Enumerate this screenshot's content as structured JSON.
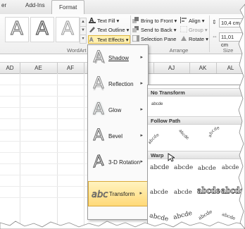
{
  "tabs": [
    "er",
    "Add-Ins",
    "Format"
  ],
  "ribbon": {
    "wordart_letter": "A",
    "group_wordart": "WordArt Styles",
    "group_arrange": "Arrange",
    "group_size": "Size",
    "text_fill": "Text Fill ▾",
    "text_outline": "Text Outline ▾",
    "text_effects": "Text Effects ▾",
    "bring_to_front": "Bring to Front ▾",
    "send_to_back": "Send to Back ▾",
    "selection_pane": "Selection Pane",
    "align": "Align ▾",
    "group": "Group ▾",
    "rotate": "Rotate ▾",
    "height_value": "10,4 cm",
    "width_value": "11,01 cm"
  },
  "columns": [
    "AD",
    "AE",
    "AF",
    "",
    "",
    "",
    "AJ",
    "AK",
    "AL"
  ],
  "text_effects_menu": {
    "items": [
      {
        "label": "Shadow",
        "icon": "shadow-a-icon"
      },
      {
        "label": "Reflection",
        "icon": "reflection-a-icon"
      },
      {
        "label": "Glow",
        "icon": "glow-a-icon"
      },
      {
        "label": "Bevel",
        "icon": "bevel-a-icon"
      },
      {
        "label": "3-D Rotation",
        "icon": "3d-rotation-a-icon"
      },
      {
        "label": "Transform",
        "icon": "transform-abc-icon"
      }
    ],
    "arrow": "▸"
  },
  "transform_gallery": {
    "no_transform_header": "No Transform",
    "no_transform_sample": "abcde",
    "follow_path_header": "Follow Path",
    "follow_path_samples": [
      "abcde",
      "abcde",
      "abcde"
    ],
    "warp_header": "Warp",
    "warp_row1": [
      "abcde",
      "abcde",
      "abcde",
      "abcde"
    ],
    "warp_row2": [
      "abcde",
      "abcde",
      "abcde",
      "abcde"
    ],
    "warp_row3": [
      "abcde",
      "abcde",
      "abcde",
      "abcde"
    ]
  }
}
